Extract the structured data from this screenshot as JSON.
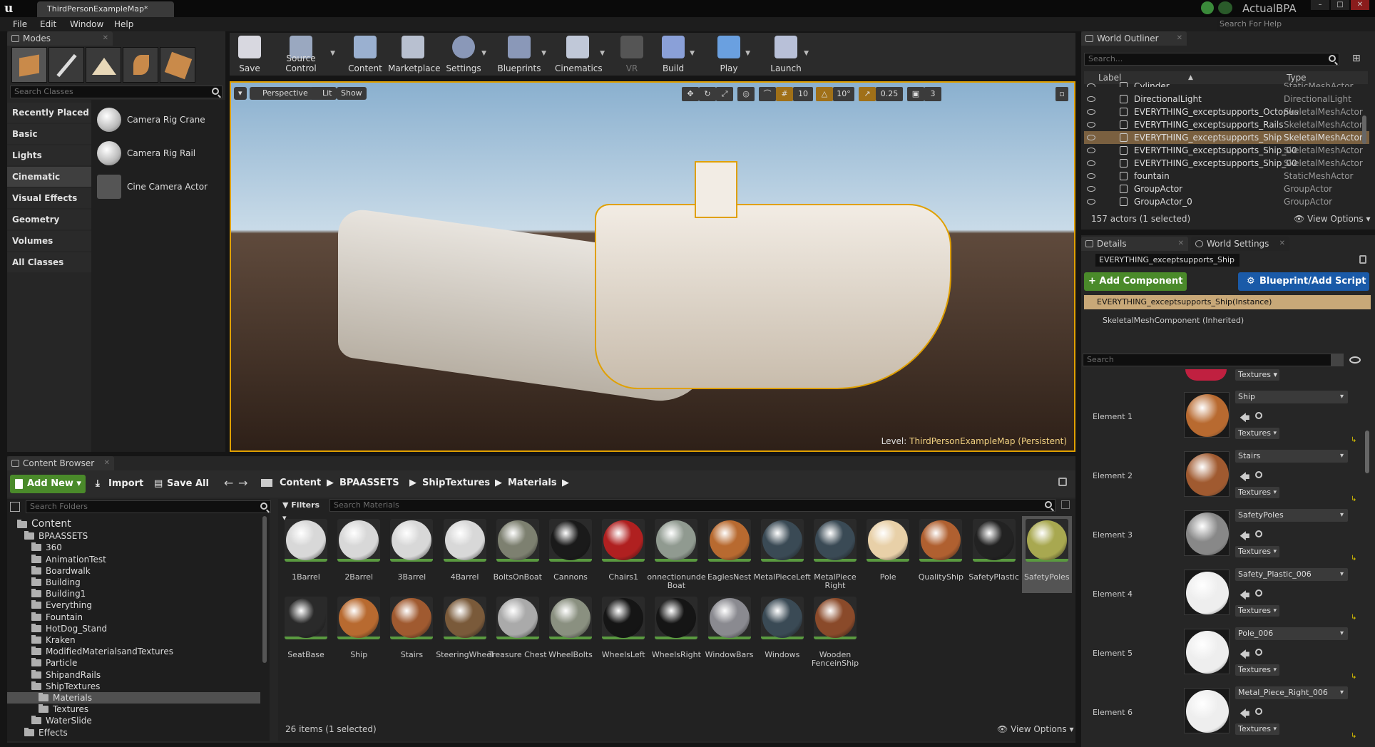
{
  "window": {
    "tab": "ThirdPersonExampleMap*",
    "brand": "ActualBPA",
    "help_search": "Search For Help"
  },
  "menu": [
    "File",
    "Edit",
    "Window",
    "Help"
  ],
  "modes": {
    "tab": "Modes",
    "search_placeholder": "Search Classes",
    "categories": [
      "Recently Placed",
      "Basic",
      "Lights",
      "Cinematic",
      "Visual Effects",
      "Geometry",
      "Volumes",
      "All Classes"
    ],
    "items": [
      "Camera Rig Crane",
      "Camera Rig Rail",
      "Cine Camera Actor"
    ]
  },
  "toolbar": {
    "items": [
      "Save",
      "Source Control",
      "Content",
      "Marketplace",
      "Settings",
      "Blueprints",
      "Cinematics",
      "VR",
      "Build",
      "Play",
      "Launch"
    ]
  },
  "viewport": {
    "perspective": "Perspective",
    "lit": "Lit",
    "show": "Show",
    "grid_snap": "10",
    "rot_snap": "10°",
    "scale_snap": "0.25",
    "cam_speed": "3",
    "level_label": "Level:",
    "level_name": "ThirdPersonExampleMap (Persistent)"
  },
  "content_browser": {
    "tab": "Content Browser",
    "add_new": "Add New",
    "import": "Import",
    "save_all": "Save All",
    "breadcrumb": [
      "Content",
      "BPAASSETS",
      "ShipTextures",
      "Materials"
    ],
    "search_folders": "Search Folders",
    "filters": "Filters",
    "search_materials": "Search Materials",
    "status": "26 items (1 selected)",
    "view_options": "View Options",
    "folders": [
      "Content",
      "BPAASSETS",
      "360",
      "AnimationTest",
      "Boardwalk",
      "Building",
      "Building1",
      "Everything",
      "Fountain",
      "HotDog_Stand",
      "Kraken",
      "ModifiedMaterialsandTextures",
      "Particle",
      "ShipandRails",
      "ShipTextures",
      "Materials",
      "Textures",
      "WaterSlide",
      "Effects"
    ],
    "assets": [
      {
        "name": "1Barrel",
        "color": "#d8d8d8"
      },
      {
        "name": "2Barrel",
        "color": "#d8d8d8"
      },
      {
        "name": "3Barrel",
        "color": "#d8d8d8"
      },
      {
        "name": "4Barrel",
        "color": "#d8d8d8"
      },
      {
        "name": "BoltsOnBoat",
        "color": "#7d8070"
      },
      {
        "name": "Cannons",
        "color": "#1a1a1a"
      },
      {
        "name": "Chairs1",
        "color": "#b02020"
      },
      {
        "name": "onnectionunde Boat",
        "color": "#909a90"
      },
      {
        "name": "EaglesNest",
        "color": "#b86a30"
      },
      {
        "name": "MetalPieceLeft",
        "color": "#3a4a55"
      },
      {
        "name": "MetalPiece Right",
        "color": "#3a4a55"
      },
      {
        "name": "Pole",
        "color": "#e8d0a8"
      },
      {
        "name": "QualityShip",
        "color": "#b06030"
      },
      {
        "name": "SafetyPlastic",
        "color": "#222"
      },
      {
        "name": "SafetyPoles",
        "color": "#a8a850"
      },
      {
        "name": "SeatBase",
        "color": "#2a2a2a"
      },
      {
        "name": "Ship",
        "color": "#b86a30"
      },
      {
        "name": "Stairs",
        "color": "#a05a30"
      },
      {
        "name": "SteeringWheel",
        "color": "#7a5a3a"
      },
      {
        "name": "Treasure Chest",
        "color": "#aaaaaa"
      },
      {
        "name": "WheelBolts",
        "color": "#8a9080"
      },
      {
        "name": "WheelsLeft",
        "color": "#151515"
      },
      {
        "name": "WheelsRight",
        "color": "#151515"
      },
      {
        "name": "WindowBars",
        "color": "#8a8a90"
      },
      {
        "name": "Windows",
        "color": "#3a4a55"
      },
      {
        "name": "Wooden FenceinShip",
        "color": "#8a4a2a"
      }
    ]
  },
  "outliner": {
    "tab": "World Outliner",
    "search": "Search...",
    "col_label": "Label",
    "col_type": "Type",
    "rows": [
      {
        "name": "Cylinder",
        "type": "StaticMeshActor"
      },
      {
        "name": "DirectionalLight",
        "type": "DirectionalLight"
      },
      {
        "name": "EVERYTHING_exceptsupports_Octopus",
        "type": "SkeletalMeshActor"
      },
      {
        "name": "EVERYTHING_exceptsupports_Rails",
        "type": "SkeletalMeshActor"
      },
      {
        "name": "EVERYTHING_exceptsupports_Ship",
        "type": "SkeletalMeshActor"
      },
      {
        "name": "EVERYTHING_exceptsupports_Ship_00",
        "type": "SkeletalMeshActor"
      },
      {
        "name": "EVERYTHING_exceptsupports_Ship_00",
        "type": "SkeletalMeshActor"
      },
      {
        "name": "fountain",
        "type": "StaticMeshActor"
      },
      {
        "name": "GroupActor",
        "type": "GroupActor"
      },
      {
        "name": "GroupActor_0",
        "type": "GroupActor"
      }
    ],
    "status": "157 actors (1 selected)",
    "view_options": "View Options"
  },
  "details": {
    "tab": "Details",
    "tab2": "World Settings",
    "actor_name": "EVERYTHING_exceptsupports_Ship",
    "add_component": "+ Add Component",
    "blueprint": "Blueprint/Add Script",
    "instance": "EVERYTHING_exceptsupports_Ship(Instance)",
    "component": "SkeletalMeshComponent (Inherited)",
    "search": "Search",
    "textures_label": "Textures",
    "elements": [
      {
        "label": "Element 1",
        "material": "Ship",
        "color": "#b86a30"
      },
      {
        "label": "Element 2",
        "material": "Stairs",
        "color": "#a05a30"
      },
      {
        "label": "Element 3",
        "material": "SafetyPoles",
        "color": "#888"
      },
      {
        "label": "Element 4",
        "material": "Safety_Plastic_006",
        "color": "#eee"
      },
      {
        "label": "Element 5",
        "material": "Pole_006",
        "color": "#eee"
      },
      {
        "label": "Element 6",
        "material": "Metal_Piece_Right_006",
        "color": "#eee"
      }
    ]
  }
}
